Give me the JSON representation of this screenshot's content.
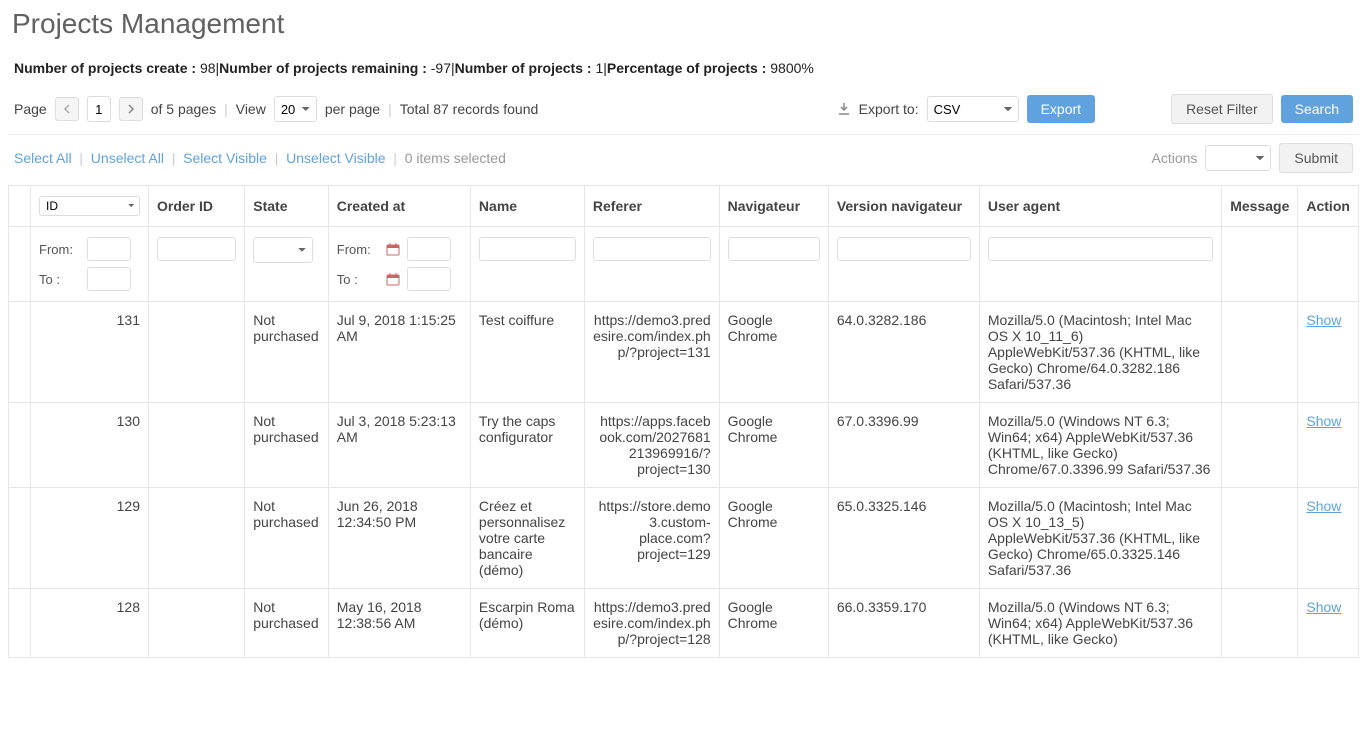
{
  "title": "Projects Management",
  "stats": {
    "created_label": "Number of projects create :",
    "created_value": "98",
    "remaining_label": "Number of projects remaining :",
    "remaining_value": "-97",
    "number_label": "Number of projects :",
    "number_value": "1",
    "percentage_label": "Percentage of projects :",
    "percentage_value": "9800%"
  },
  "toolbar": {
    "page_label": "Page",
    "page_value": "1",
    "of_pages": "of 5 pages",
    "view_label": "View",
    "per_page_value": "20",
    "per_page_label": "per page",
    "total_records": "Total 87 records found",
    "export_to_label": "Export to:",
    "export_format": "CSV",
    "export_btn": "Export",
    "reset_filter_btn": "Reset Filter",
    "search_btn": "Search"
  },
  "selection": {
    "select_all": "Select All",
    "unselect_all": "Unselect All",
    "select_visible": "Select Visible",
    "unselect_visible": "Unselect Visible",
    "items_selected": "0 items selected",
    "actions_label": "Actions",
    "submit_btn": "Submit"
  },
  "columns": {
    "id_select": "ID",
    "order_id": "Order ID",
    "state": "State",
    "created_at": "Created at",
    "name": "Name",
    "referer": "Referer",
    "navigateur": "Navigateur",
    "version": "Version navigateur",
    "user_agent": "User agent",
    "message": "Message",
    "action": "Action"
  },
  "filters": {
    "from_label": "From:",
    "to_label": "To :"
  },
  "action_label": "Show",
  "rows": [
    {
      "id": "131",
      "state": "Not purchased",
      "created_at": "Jul 9, 2018 1:15:25 AM",
      "name": "Test coiffure",
      "referer": "https://demo3.predesire.com/index.php/?project=131",
      "navigateur": "Google Chrome",
      "version": "64.0.3282.186",
      "user_agent": "Mozilla/5.0 (Macintosh; Intel Mac OS X 10_11_6) AppleWebKit/537.36 (KHTML, like Gecko) Chrome/64.0.3282.186 Safari/537.36"
    },
    {
      "id": "130",
      "state": "Not purchased",
      "created_at": "Jul 3, 2018 5:23:13 AM",
      "name": "Try the caps configurator",
      "referer": "https://apps.facebook.com/2027681213969916/?project=130",
      "navigateur": "Google Chrome",
      "version": "67.0.3396.99",
      "user_agent": "Mozilla/5.0 (Windows NT 6.3; Win64; x64) AppleWebKit/537.36 (KHTML, like Gecko) Chrome/67.0.3396.99 Safari/537.36"
    },
    {
      "id": "129",
      "state": "Not purchased",
      "created_at": "Jun 26, 2018 12:34:50 PM",
      "name": "Créez et personnalisez votre carte bancaire (démo)",
      "referer": "https://store.demo3.custom-place.com?project=129",
      "navigateur": "Google Chrome",
      "version": "65.0.3325.146",
      "user_agent": "Mozilla/5.0 (Macintosh; Intel Mac OS X 10_13_5) AppleWebKit/537.36 (KHTML, like Gecko) Chrome/65.0.3325.146 Safari/537.36"
    },
    {
      "id": "128",
      "state": "Not purchased",
      "created_at": "May 16, 2018 12:38:56 AM",
      "name": "Escarpin Roma (démo)",
      "referer": "https://demo3.predesire.com/index.php/?project=128",
      "navigateur": "Google Chrome",
      "version": "66.0.3359.170",
      "user_agent": "Mozilla/5.0 (Windows NT 6.3; Win64; x64) AppleWebKit/537.36 (KHTML, like Gecko)"
    }
  ]
}
